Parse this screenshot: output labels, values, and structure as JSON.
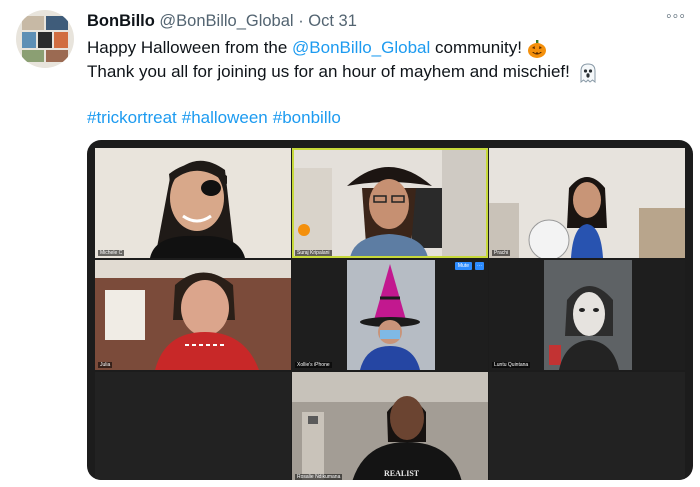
{
  "tweet": {
    "display_name": "BonBillo",
    "handle": "@BonBillo_Global",
    "separator": "·",
    "date": "Oct 31",
    "more_label": "◦◦◦",
    "line1_prefix": "Happy Halloween from the ",
    "line1_mention": "@BonBillo_Global",
    "line1_suffix": " community!",
    "line2": "Thank you all for joining us for an hour of mayhem and mischief!",
    "hashtags": [
      "#trickortreat",
      "#halloween",
      "#bonbillo"
    ],
    "emojis": [
      "jack-o-lantern-icon",
      "ghost-icon"
    ],
    "link_color": "#1d9bf0"
  },
  "video_call": {
    "participants": [
      {
        "label": "Michele C",
        "active": false
      },
      {
        "label": "Suraj Kripalani",
        "active": true
      },
      {
        "label": "Prachi",
        "active": false
      },
      {
        "label": "Julia",
        "active": false
      },
      {
        "label": "Xollie's iPhone",
        "active": false
      },
      {
        "label": "Luntu Quintana",
        "active": false
      },
      {
        "label": "Rosalie Ndikumana",
        "active": false
      }
    ],
    "mute_label": "Mute",
    "tile_menu_label": "···",
    "active_color": "#c7d93b"
  }
}
